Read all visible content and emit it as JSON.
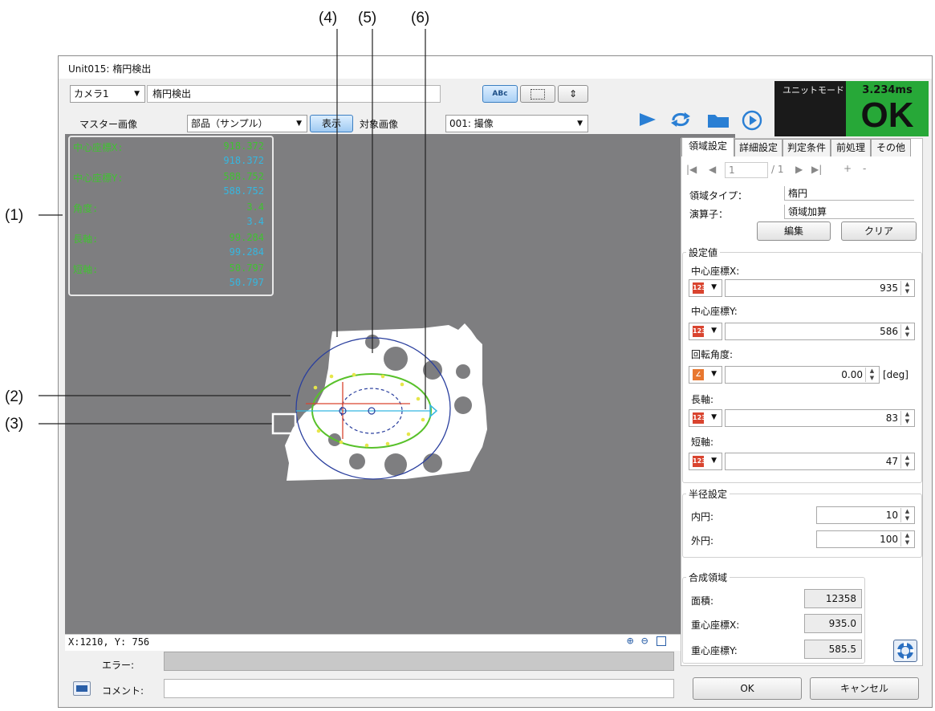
{
  "callouts": [
    "(1)",
    "(2)",
    "(3)",
    "(4)",
    "(5)",
    "(6)"
  ],
  "window": {
    "title": "Unit015: 楕円検出"
  },
  "toolbar": {
    "camera": "カメラ1",
    "unit_name": "楕円検出",
    "view_buttons": [
      "abc-view-icon",
      "region-view-icon",
      "align-view-icon"
    ],
    "master_label": "マスター画像",
    "master_select": "部品（サンプル）",
    "show_button": "表示",
    "target_label": "対象画像",
    "target_select": "001: 撮像",
    "actions": [
      "play-icon",
      "repeat-icon",
      "folder-icon",
      "circle-play-icon"
    ]
  },
  "status": {
    "mode": "ユニットモード",
    "time": "3.234ms",
    "result": "OK",
    "result_color": "#27a838"
  },
  "readout": [
    {
      "name": "中心座標X:",
      "v1": "918.372",
      "v2": "918.372"
    },
    {
      "name": "中心座標Y:",
      "v1": "588.752",
      "v2": "588.752"
    },
    {
      "name": "角度:",
      "v1": "3.4",
      "v2": "3.4"
    },
    {
      "name": "長軸:",
      "v1": "99.284",
      "v2": "99.284"
    },
    {
      "name": "短軸:",
      "v1": "50.797",
      "v2": "50.797"
    }
  ],
  "canvas": {
    "coords": "X:1210, Y: 756",
    "zoom_icons": [
      "zoom-in-icon",
      "zoom-out-icon",
      "fit-icon"
    ]
  },
  "bottom": {
    "error_label": "エラー:",
    "comment_label": "コメント:",
    "ok": "OK",
    "cancel": "キャンセル"
  },
  "tabs": [
    "領域設定",
    "詳細設定",
    "判定条件",
    "前処理",
    "その他"
  ],
  "nav": {
    "index": "1",
    "total": "/ 1",
    "plus": "+",
    "minus": "-"
  },
  "region": {
    "type_label": "領域タイプ：",
    "type_value": "楕円",
    "op_label": "演算子：",
    "op_value": "領域加算",
    "edit": "編集",
    "clear": "クリア"
  },
  "settings": {
    "title": "設定値",
    "center_x_label": "中心座標X:",
    "center_x": "935",
    "center_y_label": "中心座標Y:",
    "center_y": "586",
    "angle_label": "回転角度:",
    "angle": "0.00",
    "angle_unit": "[deg]",
    "major_label": "長軸:",
    "major": "83",
    "minor_label": "短軸:",
    "minor": "47"
  },
  "radius": {
    "title": "半径設定",
    "inner_label": "内円:",
    "inner": "10",
    "outer_label": "外円:",
    "outer": "100"
  },
  "composite": {
    "title": "合成領域",
    "area_label": "面積:",
    "area": "12358",
    "cx_label": "重心座標X:",
    "cx": "935.0",
    "cy_label": "重心座標Y:",
    "cy": "585.5"
  },
  "colors": {
    "accent": "#2a7fd4",
    "measure_green": "#41c231",
    "measure_cyan": "#35b7e0"
  }
}
